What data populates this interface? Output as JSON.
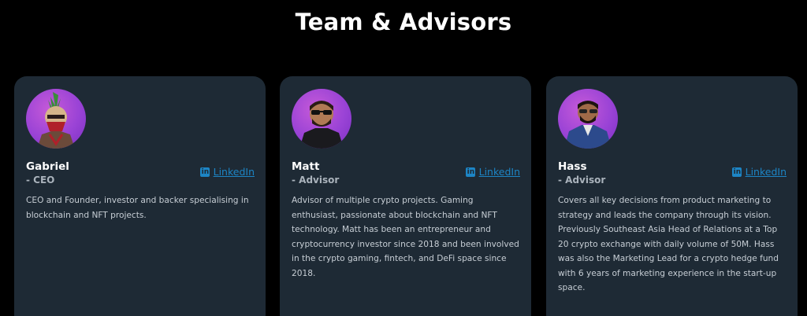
{
  "section": {
    "title": "Team & Advisors"
  },
  "members": [
    {
      "name": "Gabriel",
      "role": "- CEO",
      "link_label": "LinkedIn",
      "bio": "CEO and Founder, investor and backer specialising in blockchain and NFT projects.",
      "avatar_icon": "punk-mohawk-avatar-icon"
    },
    {
      "name": "Matt",
      "role": "- Advisor",
      "link_label": "LinkedIn",
      "bio": "Advisor of multiple crypto projects. Gaming enthusiast, passionate about blockchain and NFT technology. Matt has been an entrepreneur and cryptocurrency investor since 2018 and been involved in the crypto gaming, fintech, and DeFi space since 2018.",
      "avatar_icon": "person-sunglasses-avatar-icon"
    },
    {
      "name": "Hass",
      "role": "- Advisor",
      "link_label": "LinkedIn",
      "bio": "Covers all key decisions from product marketing to strategy and leads the company through its vision. Previously Southeast Asia Head of Relations at a Top 20 crypto exchange with daily volume of 50M. Hass was also the Marketing Lead for a crypto hedge fund with 6 years of marketing experience in the start-up space.",
      "avatar_icon": "person-suit-avatar-icon"
    }
  ],
  "colors": {
    "background": "#000000",
    "card": "#1e2a35",
    "link": "#1d85c5",
    "avatar_gradient": "#9a43d6"
  },
  "icons": {
    "linkedin": "linkedin-icon"
  }
}
